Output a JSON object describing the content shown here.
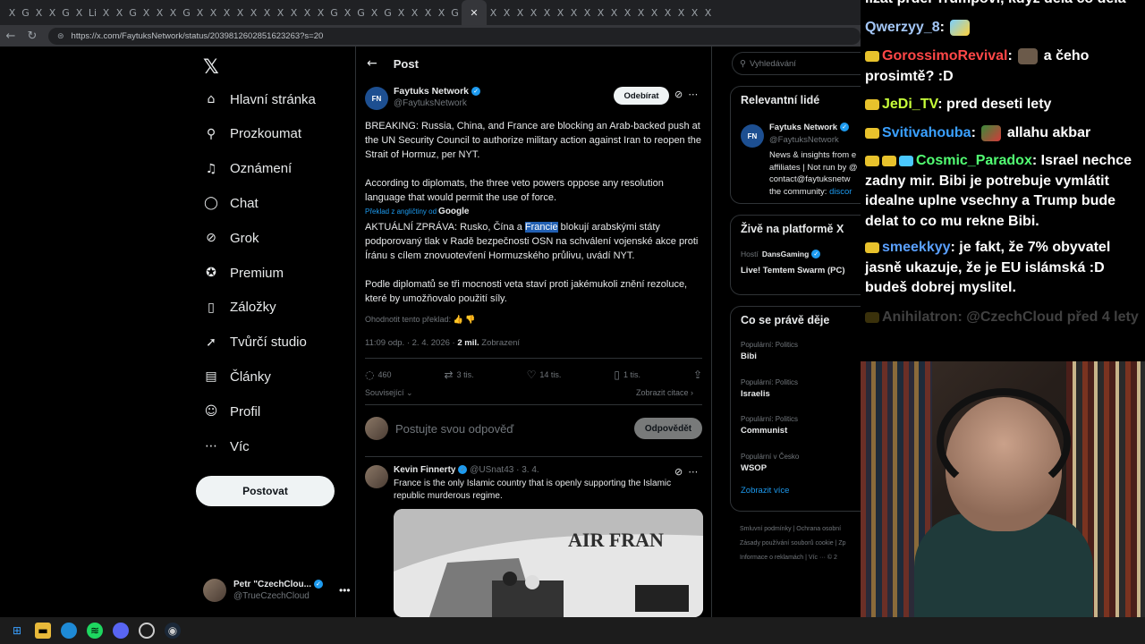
{
  "browser": {
    "url": "https://x.com/FaytuksNetwork/status/2039812602851623263?s=20",
    "tab_icons": [
      "X",
      "G",
      "X",
      "X",
      "G",
      "X",
      "Li",
      "X",
      "X",
      "G",
      "X",
      "X",
      "X",
      "G",
      "X",
      "X",
      "X",
      "X",
      "X",
      "X",
      "X",
      "X",
      "X",
      "X",
      "G",
      "X",
      "G",
      "X",
      "G",
      "X",
      "X",
      "X",
      "X",
      "G",
      "X",
      "X",
      "X",
      "X",
      "X",
      "X",
      "X",
      "X",
      "X",
      "X",
      "X",
      "X",
      "X",
      "X",
      "X",
      "X",
      "X",
      "X"
    ]
  },
  "nav": {
    "items": [
      {
        "label": "Hlavní stránka",
        "icon": "home-icon",
        "glyph": "⌂"
      },
      {
        "label": "Prozkoumat",
        "icon": "search-icon",
        "glyph": "⚲"
      },
      {
        "label": "Oznámení",
        "icon": "bell-icon",
        "glyph": "♫"
      },
      {
        "label": "Chat",
        "icon": "chat-icon",
        "glyph": "◯"
      },
      {
        "label": "Grok",
        "icon": "grok-icon",
        "glyph": "⊘"
      },
      {
        "label": "Premium",
        "icon": "premium-icon",
        "glyph": "✪"
      },
      {
        "label": "Záložky",
        "icon": "bookmark-icon",
        "glyph": "▯"
      },
      {
        "label": "Tvůrčí studio",
        "icon": "rocket-icon",
        "glyph": "➚"
      },
      {
        "label": "Články",
        "icon": "articles-icon",
        "glyph": "▤"
      },
      {
        "label": "Profil",
        "icon": "profile-icon",
        "glyph": "☺"
      },
      {
        "label": "Víc",
        "icon": "more-icon",
        "glyph": "⋯"
      }
    ],
    "post_button": "Postovat",
    "account_name": "Petr \"CzechClou...",
    "account_handle": "@TrueCzechCloud"
  },
  "main": {
    "header_title": "Post",
    "author_name": "Faytuks Network",
    "author_handle": "@FaytuksNetwork",
    "follow_label": "Odebírat",
    "para1": "BREAKING: Russia, China, and France are blocking an Arab-backed push at the UN Security Council to authorize military action against Iran to reopen the Strait of Hormuz, per NYT.",
    "para2": "According to diplomats, the three veto powers oppose any resolution language that would permit the use of force.",
    "translated_label": "Překlad z angličtiny od",
    "translated_brand": "Google",
    "trans1_before": "AKTUÁLNÍ ZPRÁVA: Rusko, Čína a ",
    "trans1_highlight": "Francie",
    "trans1_after": " blokují arabskými státy podporovaný tlak v Radě bezpečnosti OSN na schválení vojenské akce proti Íránu s cílem znovuotevření Hormuzského průlivu, uvádí NYT.",
    "trans2": "Podle diplomatů se tři mocnosti veta staví proti jakémukoli znění rezoluce, které by umožňovalo použití síly.",
    "rate_label": "Ohodnotit tento překlad:",
    "time": "11:09 odp. · 2. 4. 2026 · ",
    "views_count": "2 mil.",
    "views_label": " Zobrazení",
    "replies": "460",
    "reposts": "3 tis.",
    "likes": "14 tis.",
    "bookmarks": "1 tis.",
    "related": "Související",
    "quotes": "Zobrazit citace",
    "reply_placeholder": "Postujte svou odpověď",
    "reply_button": "Odpovědět",
    "reply_author": "Kevin Finnerty",
    "reply_meta": " @USnat43 · 3. 4.",
    "reply_text": "France is the only Islamic country that is openly supporting the Islamic republic murderous regime.",
    "photo_text": "AIR FRAN"
  },
  "sidebar": {
    "search_placeholder": "Vyhledávání",
    "relevant_title": "Relevantní lidé",
    "rp_name": "Faytuks Network",
    "rp_handle": "@FaytuksNetwork",
    "rp_bio1": "News & insights from e",
    "rp_bio2": "affiliates | Not run by @",
    "rp_bio3": "contact@faytuksnetw",
    "rp_bio4": "the community: ",
    "rp_bio4_link": "discor",
    "live_title": "Živě na platformě X",
    "live_host_label": "Hostí",
    "live_host": "DansGaming",
    "live_stream": "Live! Temtem Swarm (PC)",
    "trending_title": "Co se právě děje",
    "trends": [
      {
        "cat": "Populární: Politics",
        "term": "Bibi"
      },
      {
        "cat": "Populární: Politics",
        "term": "Israelis"
      },
      {
        "cat": "Populární: Politics",
        "term": "Communist"
      },
      {
        "cat": "Populární v Česko",
        "term": "WSOP"
      }
    ],
    "show_more": "Zobrazit více",
    "footer1": "Smluvní podmínky  |  Ochrana osobní",
    "footer2": "Zásady používání souborů cookie  |  Zp",
    "footer3": "Informace o reklamách  |  Víc ···  © 2"
  },
  "chat": {
    "m0_text": "lízat prdel Trumpovi, když dělá co dělá",
    "m1_user": "Qwerzyy_8",
    "m1_text": "",
    "m2_user": "GorossimoRevival",
    "m2_text": "a čeho prosimtě? :D",
    "m3_user": "JeDi_TV",
    "m3_text": "pred deseti lety",
    "m4_user": "Svitivahouba",
    "m4_text": "allahu akbar",
    "m5_user": "Cosmic_Paradox",
    "m5_text": "Israel nechce zadny mir. Bibi je potrebuje vymlátit idealne uplne vsechny a Trump bude delat to co mu rekne Bibi.",
    "m6_user": "smeekkyy",
    "m6_text": "je fakt, že 7% obyvatel jasně ukazuje, že je EU islámská :D budeš dobrej myslitel.",
    "m7_user": "Anihilatron",
    "m7_text": "@CzechCloud před 4 lety",
    "colors": {
      "qwerzyy": "#a3c6f5",
      "gorossimo": "#ff4747",
      "jedi": "#c8ff3a",
      "sviti": "#3aa0ff",
      "cosmic": "#52ff73",
      "smeek": "#5aa0ff"
    }
  },
  "taskbar": {
    "icons": [
      "windows-icon",
      "explorer-icon",
      "edge-icon",
      "spotify-icon",
      "discord-icon",
      "obs-icon",
      "steam-icon"
    ]
  }
}
